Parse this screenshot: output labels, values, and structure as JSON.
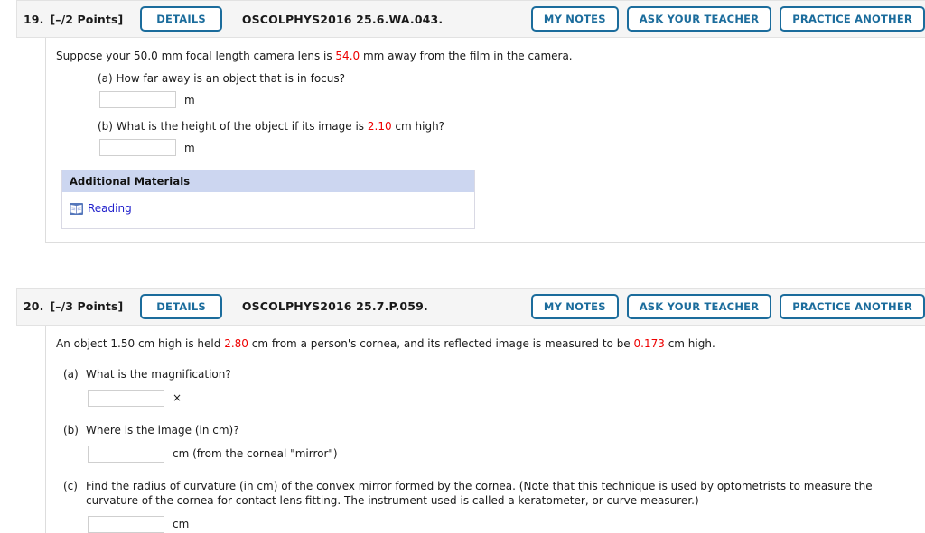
{
  "questions": [
    {
      "number": "19.",
      "points": "[–/2 Points]",
      "details_label": "DETAILS",
      "code": "OSCOLPHYS2016 25.6.WA.043.",
      "actions": {
        "my_notes": "MY NOTES",
        "ask_your_teacher": "ASK YOUR TEACHER",
        "practice_another": "PRACTICE ANOTHER"
      },
      "stem": {
        "before": "Suppose your 50.0 mm focal length camera lens is ",
        "value": "54.0",
        "after": " mm away from the film in the camera."
      },
      "parts": [
        {
          "text": "(a) How far away is an object that is in focus?",
          "input_value": "",
          "unit": "m"
        },
        {
          "text_before": "(b) What is the height of the object if its image is ",
          "value": "2.10",
          "text_after": " cm high?",
          "input_value": "",
          "unit": "m"
        }
      ],
      "materials": {
        "header": "Additional Materials",
        "link_label": "Reading",
        "icon": "book-icon"
      }
    },
    {
      "number": "20.",
      "points": "[–/3 Points]",
      "details_label": "DETAILS",
      "code": "OSCOLPHYS2016 25.7.P.059.",
      "actions": {
        "my_notes": "MY NOTES",
        "ask_your_teacher": "ASK YOUR TEACHER",
        "practice_another": "PRACTICE ANOTHER"
      },
      "stem": {
        "p1": "An object 1.50 cm high is held ",
        "v1": "2.80",
        "p2": " cm from a person's cornea, and its reflected image is measured to be ",
        "v2": "0.173",
        "p3": " cm high."
      },
      "parts": [
        {
          "label": "(a)",
          "text": "What is the magnification?",
          "input_value": "",
          "unit": "×"
        },
        {
          "label": "(b)",
          "text": "Where is the image (in cm)?",
          "input_value": "",
          "unit": "cm (from the corneal \"mirror\")"
        },
        {
          "label": "(c)",
          "text": "Find the radius of curvature (in cm) of the convex mirror formed by the cornea. (Note that this technique is used by optometrists to measure the curvature of the cornea for contact lens fitting. The instrument used is called a keratometer, or curve measurer.)",
          "input_value": "",
          "unit": "cm"
        }
      ]
    }
  ],
  "colors": {
    "accent": "#1b6c9c",
    "highlight": "#ee0000",
    "header_bg": "#f5f5f5",
    "materials_header_bg": "#ccd6f0",
    "link": "#2222cc"
  }
}
